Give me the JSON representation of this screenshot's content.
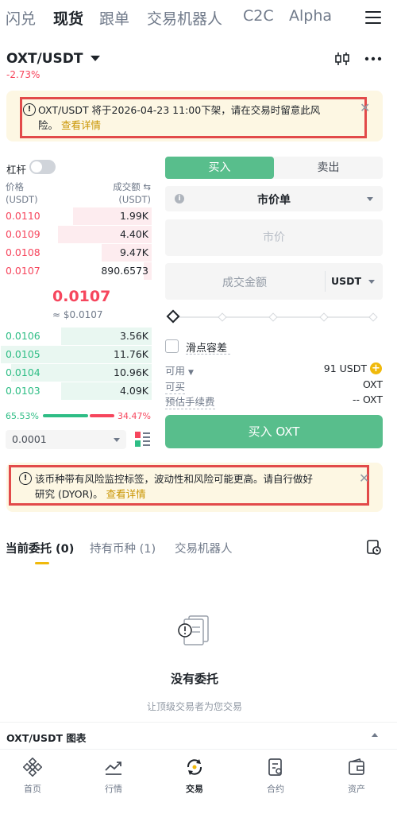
{
  "top_tabs": [
    "闪兑",
    "现货",
    "跟单",
    "交易机器人",
    "C2C",
    "Alpha"
  ],
  "pair": {
    "symbol": "OXT/USDT",
    "change": "-2.73%"
  },
  "delist_notice": {
    "text": "OXT/USDT 将于2026-04-23 11:00下架，请在交易时留意此风",
    "text_line2": "险。",
    "link": "查看详情"
  },
  "order_book": {
    "leverage_label": "杠杆",
    "header": {
      "price": "价格",
      "price_unit": "(USDT)",
      "amount": "成交额",
      "amount_unit": "(USDT)"
    },
    "asks": [
      {
        "price": "0.0110",
        "amount": "1.99K",
        "depth": 0.52
      },
      {
        "price": "0.0109",
        "amount": "4.40K",
        "depth": 0.62
      },
      {
        "price": "0.0108",
        "amount": "9.47K",
        "depth": 0.33
      },
      {
        "price": "0.0107",
        "amount": "890.6573",
        "depth": 0.05
      }
    ],
    "last_price": "0.0107",
    "last_price_usd": "≈ $0.0107",
    "bids": [
      {
        "price": "0.0106",
        "amount": "3.56K",
        "depth": 0.6
      },
      {
        "price": "0.0105",
        "amount": "11.76K",
        "depth": 1.0
      },
      {
        "price": "0.0104",
        "amount": "10.96K",
        "depth": 0.93
      },
      {
        "price": "0.0103",
        "amount": "4.09K",
        "depth": 0.6
      }
    ],
    "buy_ratio": "65.53%",
    "sell_ratio": "34.47%",
    "precision": "0.0001"
  },
  "trade": {
    "buy_tab": "买入",
    "sell_tab": "卖出",
    "order_type": "市价单",
    "market_price_placeholder": "市价",
    "amount_placeholder": "成交金额",
    "amount_unit": "USDT",
    "slippage_label": "滑点容差",
    "available_label": "可用",
    "available_value": "91 USDT",
    "can_buy_label": "可买",
    "can_buy_value": "OXT",
    "fee_label": "预估手续费",
    "fee_value": "-- OXT",
    "buy_button": "买入 OXT"
  },
  "risk_notice": {
    "text": "该币种带有风险监控标签，波动性和风险可能更高。请自行做好",
    "text_line2": "研究 (DYOR)。",
    "link": "查看详情"
  },
  "order_tabs": {
    "current": "当前委托 (0)",
    "holdings": "持有币种 (1)",
    "bots": "交易机器人"
  },
  "empty": {
    "title": "没有委托",
    "subtitle": "让顶级交易者为您交易"
  },
  "chart_bar_label": "OXT/USDT 图表",
  "nav": [
    "首页",
    "行情",
    "交易",
    "合约",
    "资产"
  ],
  "colors": {
    "buy": "#58be8c",
    "sell": "#f6465d",
    "accent": "#f0b90b"
  }
}
